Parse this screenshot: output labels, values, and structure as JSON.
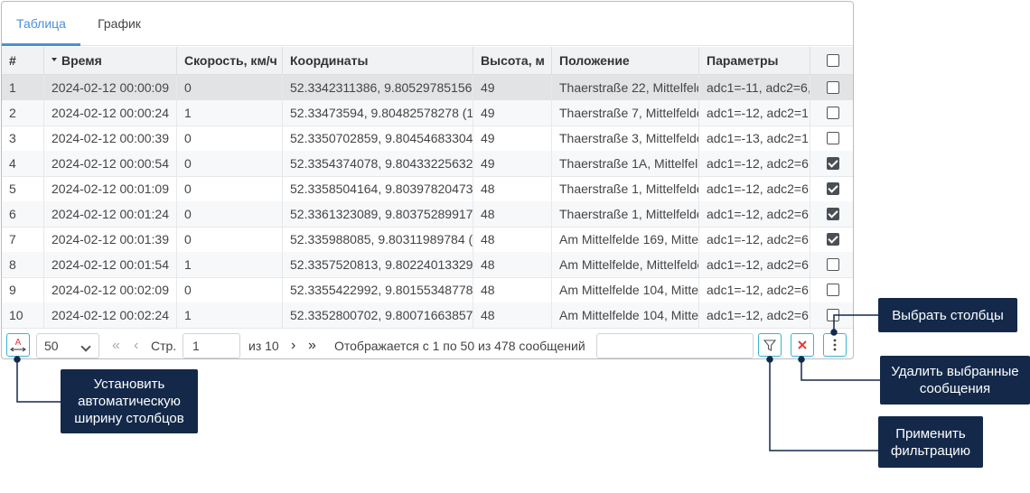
{
  "tabs": [
    {
      "label": "Таблица",
      "active": true
    },
    {
      "label": "График",
      "active": false
    }
  ],
  "columns": {
    "num": "#",
    "time": "Время",
    "speed": "Скорость, км/ч",
    "coords": "Координаты",
    "height": "Высота, м",
    "position": "Положение",
    "params": "Параметры"
  },
  "rows": [
    {
      "num": "1",
      "time": "2024-02-12 00:00:09",
      "speed": "0",
      "coords": "52.3342311386, 9.80529785156",
      "height": "49",
      "position": "Thaerstraße 22, Mittelfelde",
      "params": "adc1=-11, adc2=6,",
      "checked": false
    },
    {
      "num": "2",
      "time": "2024-02-12 00:00:24",
      "speed": "1",
      "coords": "52.33473594, 9.80482578278 (1",
      "height": "49",
      "position": "Thaerstraße 7, Mittelfelde",
      "params": "adc1=-12, adc2=1",
      "checked": false
    },
    {
      "num": "3",
      "time": "2024-02-12 00:00:39",
      "speed": "0",
      "coords": "52.3350702859, 9.80454683304",
      "height": "49",
      "position": "Thaerstraße 3, Mittelfelde",
      "params": "adc1=-13, adc2=1",
      "checked": false
    },
    {
      "num": "4",
      "time": "2024-02-12 00:00:54",
      "speed": "0",
      "coords": "52.3354374078, 9.80433225632",
      "height": "49",
      "position": "Thaerstraße 1A, Mittelfelde",
      "params": "adc1=-12, adc2=6",
      "checked": true
    },
    {
      "num": "5",
      "time": "2024-02-12 00:01:09",
      "speed": "0",
      "coords": "52.3358504164, 9.80397820473",
      "height": "48",
      "position": "Thaerstraße 1, Mittelfelde",
      "params": "adc1=-12, adc2=6",
      "checked": true
    },
    {
      "num": "6",
      "time": "2024-02-12 00:01:24",
      "speed": "0",
      "coords": "52.3361323089, 9.80375289917",
      "height": "48",
      "position": "Thaerstraße 1, Mittelfelde",
      "params": "adc1=-12, adc2=6",
      "checked": true
    },
    {
      "num": "7",
      "time": "2024-02-12 00:01:39",
      "speed": "0",
      "coords": "52.335988085, 9.80311989784 (",
      "height": "48",
      "position": "Am Mittelfelde 169, Mittelfelde",
      "params": "adc1=-12, adc2=6",
      "checked": true
    },
    {
      "num": "8",
      "time": "2024-02-12 00:01:54",
      "speed": "1",
      "coords": "52.3357520813, 9.80224013329",
      "height": "48",
      "position": "Am Mittelfelde, Mittelfelde",
      "params": "adc1=-12, adc2=6",
      "checked": false
    },
    {
      "num": "9",
      "time": "2024-02-12 00:02:09",
      "speed": "0",
      "coords": "52.3355422992, 9.80155348778",
      "height": "48",
      "position": "Am Mittelfelde 104, Mittelfelde",
      "params": "adc1=-12, adc2=6",
      "checked": false
    },
    {
      "num": "10",
      "time": "2024-02-12 00:02:24",
      "speed": "1",
      "coords": "52.3352800702, 9.80071663857",
      "height": "48",
      "position": "Am Mittelfelde 104, Mittelfelde",
      "params": "adc1=-12, adc2=6",
      "checked": false
    }
  ],
  "footer": {
    "autowidth_icon": "A",
    "page_size": "50",
    "page_label": "Стр.",
    "page_value": "1",
    "page_total": "из 10",
    "info": "Отображается с 1 по 50 из 478 сообщений",
    "search_value": "",
    "filter_icon": "filter-icon",
    "delete_icon": "close-icon",
    "more_icon": "more-vertical-icon"
  },
  "callouts": {
    "autowidth": "Установить автоматическую ширину столбцов",
    "columns": "Выбрать столбцы",
    "delete": "Удалить выбранные сообщения",
    "filter": "Применить фильтрацию"
  },
  "colors": {
    "accent": "#4b8fd8",
    "button_border": "#3ab4d0",
    "delete_red": "#e53935",
    "callout_bg": "#14294a",
    "selected_row": "#e1e3e5"
  }
}
